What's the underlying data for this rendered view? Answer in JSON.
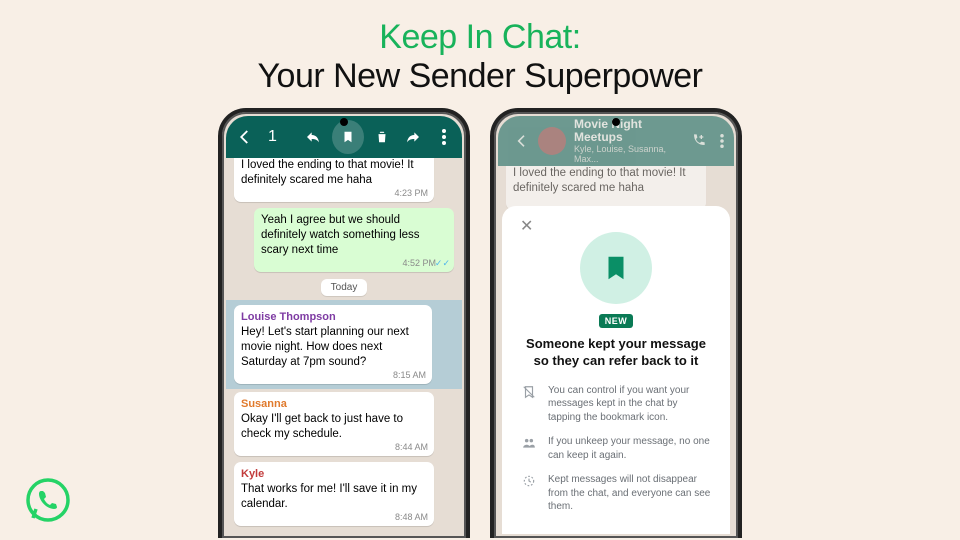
{
  "heading": {
    "line1": "Keep In Chat:",
    "line2": "Your New Sender Superpower"
  },
  "phone1": {
    "header": {
      "count": "1"
    },
    "msg1": {
      "text": "I loved the ending to that movie! It definitely scared me haha",
      "time": "4:23 PM"
    },
    "msg2": {
      "text": "Yeah I agree but we should definitely watch something less scary next time",
      "time": "4:52 PM"
    },
    "date_chip": "Today",
    "msg3": {
      "sender": "Louise Thompson",
      "text": "Hey! Let's start planning our next movie night. How does next Saturday at 7pm sound?",
      "time": "8:15 AM"
    },
    "msg4": {
      "sender": "Susanna",
      "text": "Okay I'll get back to just have to check my schedule.",
      "time": "8:44 AM"
    },
    "msg5": {
      "sender": "Kyle",
      "text": "That works for me! I'll save it in my calendar.",
      "time": "8:48 AM"
    }
  },
  "phone2": {
    "header": {
      "title": "Movie Night Meetups",
      "sub": "Kyle, Louise, Susanna, Max..."
    },
    "msg1": {
      "text": "I loved the ending to that movie! It definitely scared me haha"
    },
    "sheet": {
      "new_label": "NEW",
      "title": "Someone kept your message so they can refer back to it",
      "rows": [
        "You can control if you want your messages kept in the chat by tapping the bookmark icon.",
        "If you unkeep your message, no one can keep it again.",
        "Kept messages will not disappear from the chat, and everyone can see them."
      ]
    }
  }
}
